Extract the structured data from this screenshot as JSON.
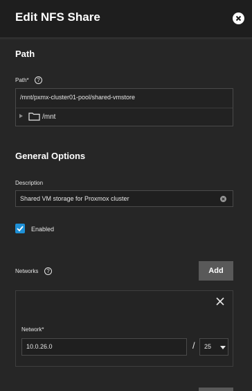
{
  "header": {
    "title": "Edit NFS Share"
  },
  "path_section": {
    "title": "Path",
    "label": "Path",
    "required_mark": "*",
    "value": "/mnt/pxmx-cluster01-pool/shared-vmstore",
    "tree_item": "/mnt"
  },
  "general_section": {
    "title": "General Options",
    "description_label": "Description",
    "description_value": "Shared VM storage for Proxmox cluster",
    "enabled_label": "Enabled",
    "enabled_checked": true
  },
  "networks": {
    "label": "Networks",
    "add_label": "Add",
    "items": [
      {
        "network_label": "Network",
        "required_mark": "*",
        "address": "10.0.26.0",
        "separator": "/",
        "mask": "25"
      }
    ]
  },
  "colors": {
    "accent": "#1e90d6",
    "header_bg": "#1e1e1e",
    "panel_bg": "#262626",
    "button_bg": "#595959"
  }
}
